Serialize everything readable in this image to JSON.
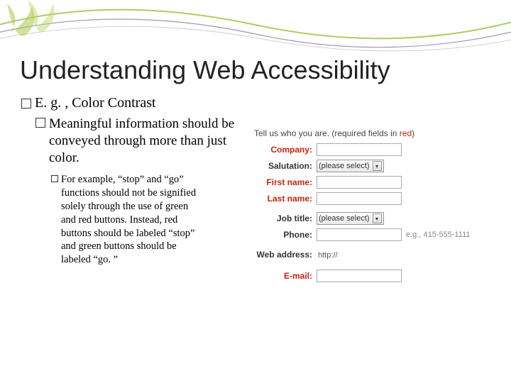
{
  "title": "Understanding Web Accessibility",
  "bullet1": "E. g. , Color Contrast",
  "bullet2": "Meaningful information should be conveyed through more than just color.",
  "bullet3": "For example, “stop” and “go” functions should not be signified solely through the use of green and red buttons. Instead, red buttons should be labeled “stop” and green buttons should be labeled “go. ”",
  "form": {
    "hint_prefix": "Tell us who you are.  (required fields in ",
    "hint_req": "red",
    "hint_suffix": ")",
    "rows": {
      "company": {
        "label": "Company:"
      },
      "salutation": {
        "label": "Salutation:",
        "select": "(please select)"
      },
      "firstname": {
        "label": "First name:"
      },
      "lastname": {
        "label": "Last name:"
      },
      "jobtitle": {
        "label": "Job title:",
        "select": "(please select)"
      },
      "phone": {
        "label": "Phone:",
        "hint": "e.g., 415-555-1111"
      },
      "web": {
        "label": "Web address:",
        "static": "http://"
      },
      "email": {
        "label": "E-mail:"
      }
    }
  }
}
